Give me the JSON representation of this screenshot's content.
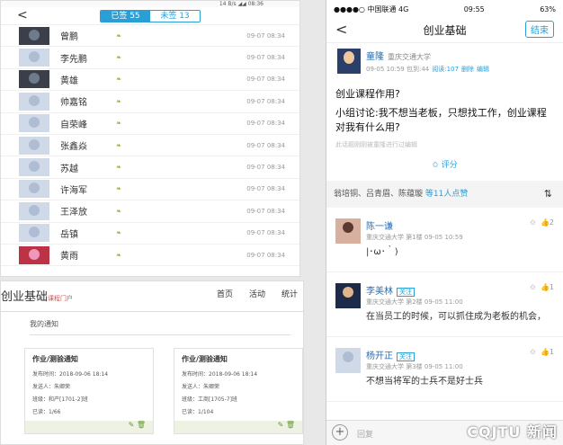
{
  "p1": {
    "status": "14 B/s ◢◢ 08:36",
    "tab_signed": "已签 55",
    "tab_unsigned": "未签 13",
    "rows": [
      {
        "name": "曾鹏",
        "time": "09-07 08:34",
        "av": "dark"
      },
      {
        "name": "李先鹏",
        "time": "09-07 08:34",
        "av": ""
      },
      {
        "name": "黄雄",
        "time": "09-07 08:34",
        "av": "dark"
      },
      {
        "name": "帅嘉铭",
        "time": "09-07 08:34",
        "av": ""
      },
      {
        "name": "自荣峰",
        "time": "09-07 08:34",
        "av": ""
      },
      {
        "name": "张鑫焱",
        "time": "09-07 08:34",
        "av": ""
      },
      {
        "name": "苏越",
        "time": "09-07 08:34",
        "av": ""
      },
      {
        "name": "许海军",
        "time": "09-07 08:34",
        "av": ""
      },
      {
        "name": "王泽放",
        "time": "09-07 08:34",
        "av": ""
      },
      {
        "name": "岳镇",
        "time": "09-07 08:34",
        "av": ""
      },
      {
        "name": "黄雨",
        "time": "09-07 08:34",
        "av": "red"
      }
    ]
  },
  "p2": {
    "brand": "创业基础",
    "brand_sub": "课程门户",
    "nav": [
      "首页",
      "活动",
      "统计"
    ],
    "notice_title": "我的通知",
    "cards": [
      {
        "title": "作业/测验通知",
        "date": "发布时间：2018-09-06 18:14",
        "sender": "发送人：朱卿荣",
        "cls": "班级：和产[1701-2]班",
        "read": "已读：1/66"
      },
      {
        "title": "作业/测验通知",
        "date": "发布时间：2018-09-06 18:14",
        "sender": "发送人：朱卿荣",
        "cls": "班级：工商[1705-7]班",
        "read": "已读：1/104"
      }
    ]
  },
  "p3": {
    "carrier": "●●●●○ 中国联通  4G",
    "time": "09:55",
    "battery": "63%",
    "title": "创业基础",
    "end": "结束",
    "author": "童隆",
    "school": "重庆交通大学",
    "meta": "09-05 10:59  包到:44",
    "reads": "阅读:107",
    "del": "删除",
    "edit": "编辑",
    "q1": "创业课程作用?",
    "q2": "小组讨论:我不想当老板，只想找工作，创业课程对我有什么用?",
    "edited": "此话题刚刚被童隆进行过编辑",
    "rate": "评分",
    "likes_names": "翁培铜、吕青眉、陈蕴璇",
    "likes_count": "等11人点赞",
    "comments": [
      {
        "name": "陈一谦",
        "tag": "",
        "meta": "重庆交通大学 第1楼  09-05 10:59",
        "text": "|･ω･｀)",
        "likes": "2",
        "av": "girl"
      },
      {
        "name": "李美林",
        "tag": "关注",
        "meta": "重庆交通大学 第2楼  09-05 11:00",
        "text": "在当员工的时候，可以抓住成为老板的机会，",
        "likes": "1",
        "av": "dk"
      },
      {
        "name": "杨开正",
        "tag": "关注",
        "meta": "重庆交通大学 第3楼  09-05 11:00",
        "text": "不想当将军的士兵不是好士兵",
        "likes": "1",
        "av": ""
      }
    ],
    "input_placeholder": "回复",
    "watermark": "CQJTU 新闻"
  }
}
